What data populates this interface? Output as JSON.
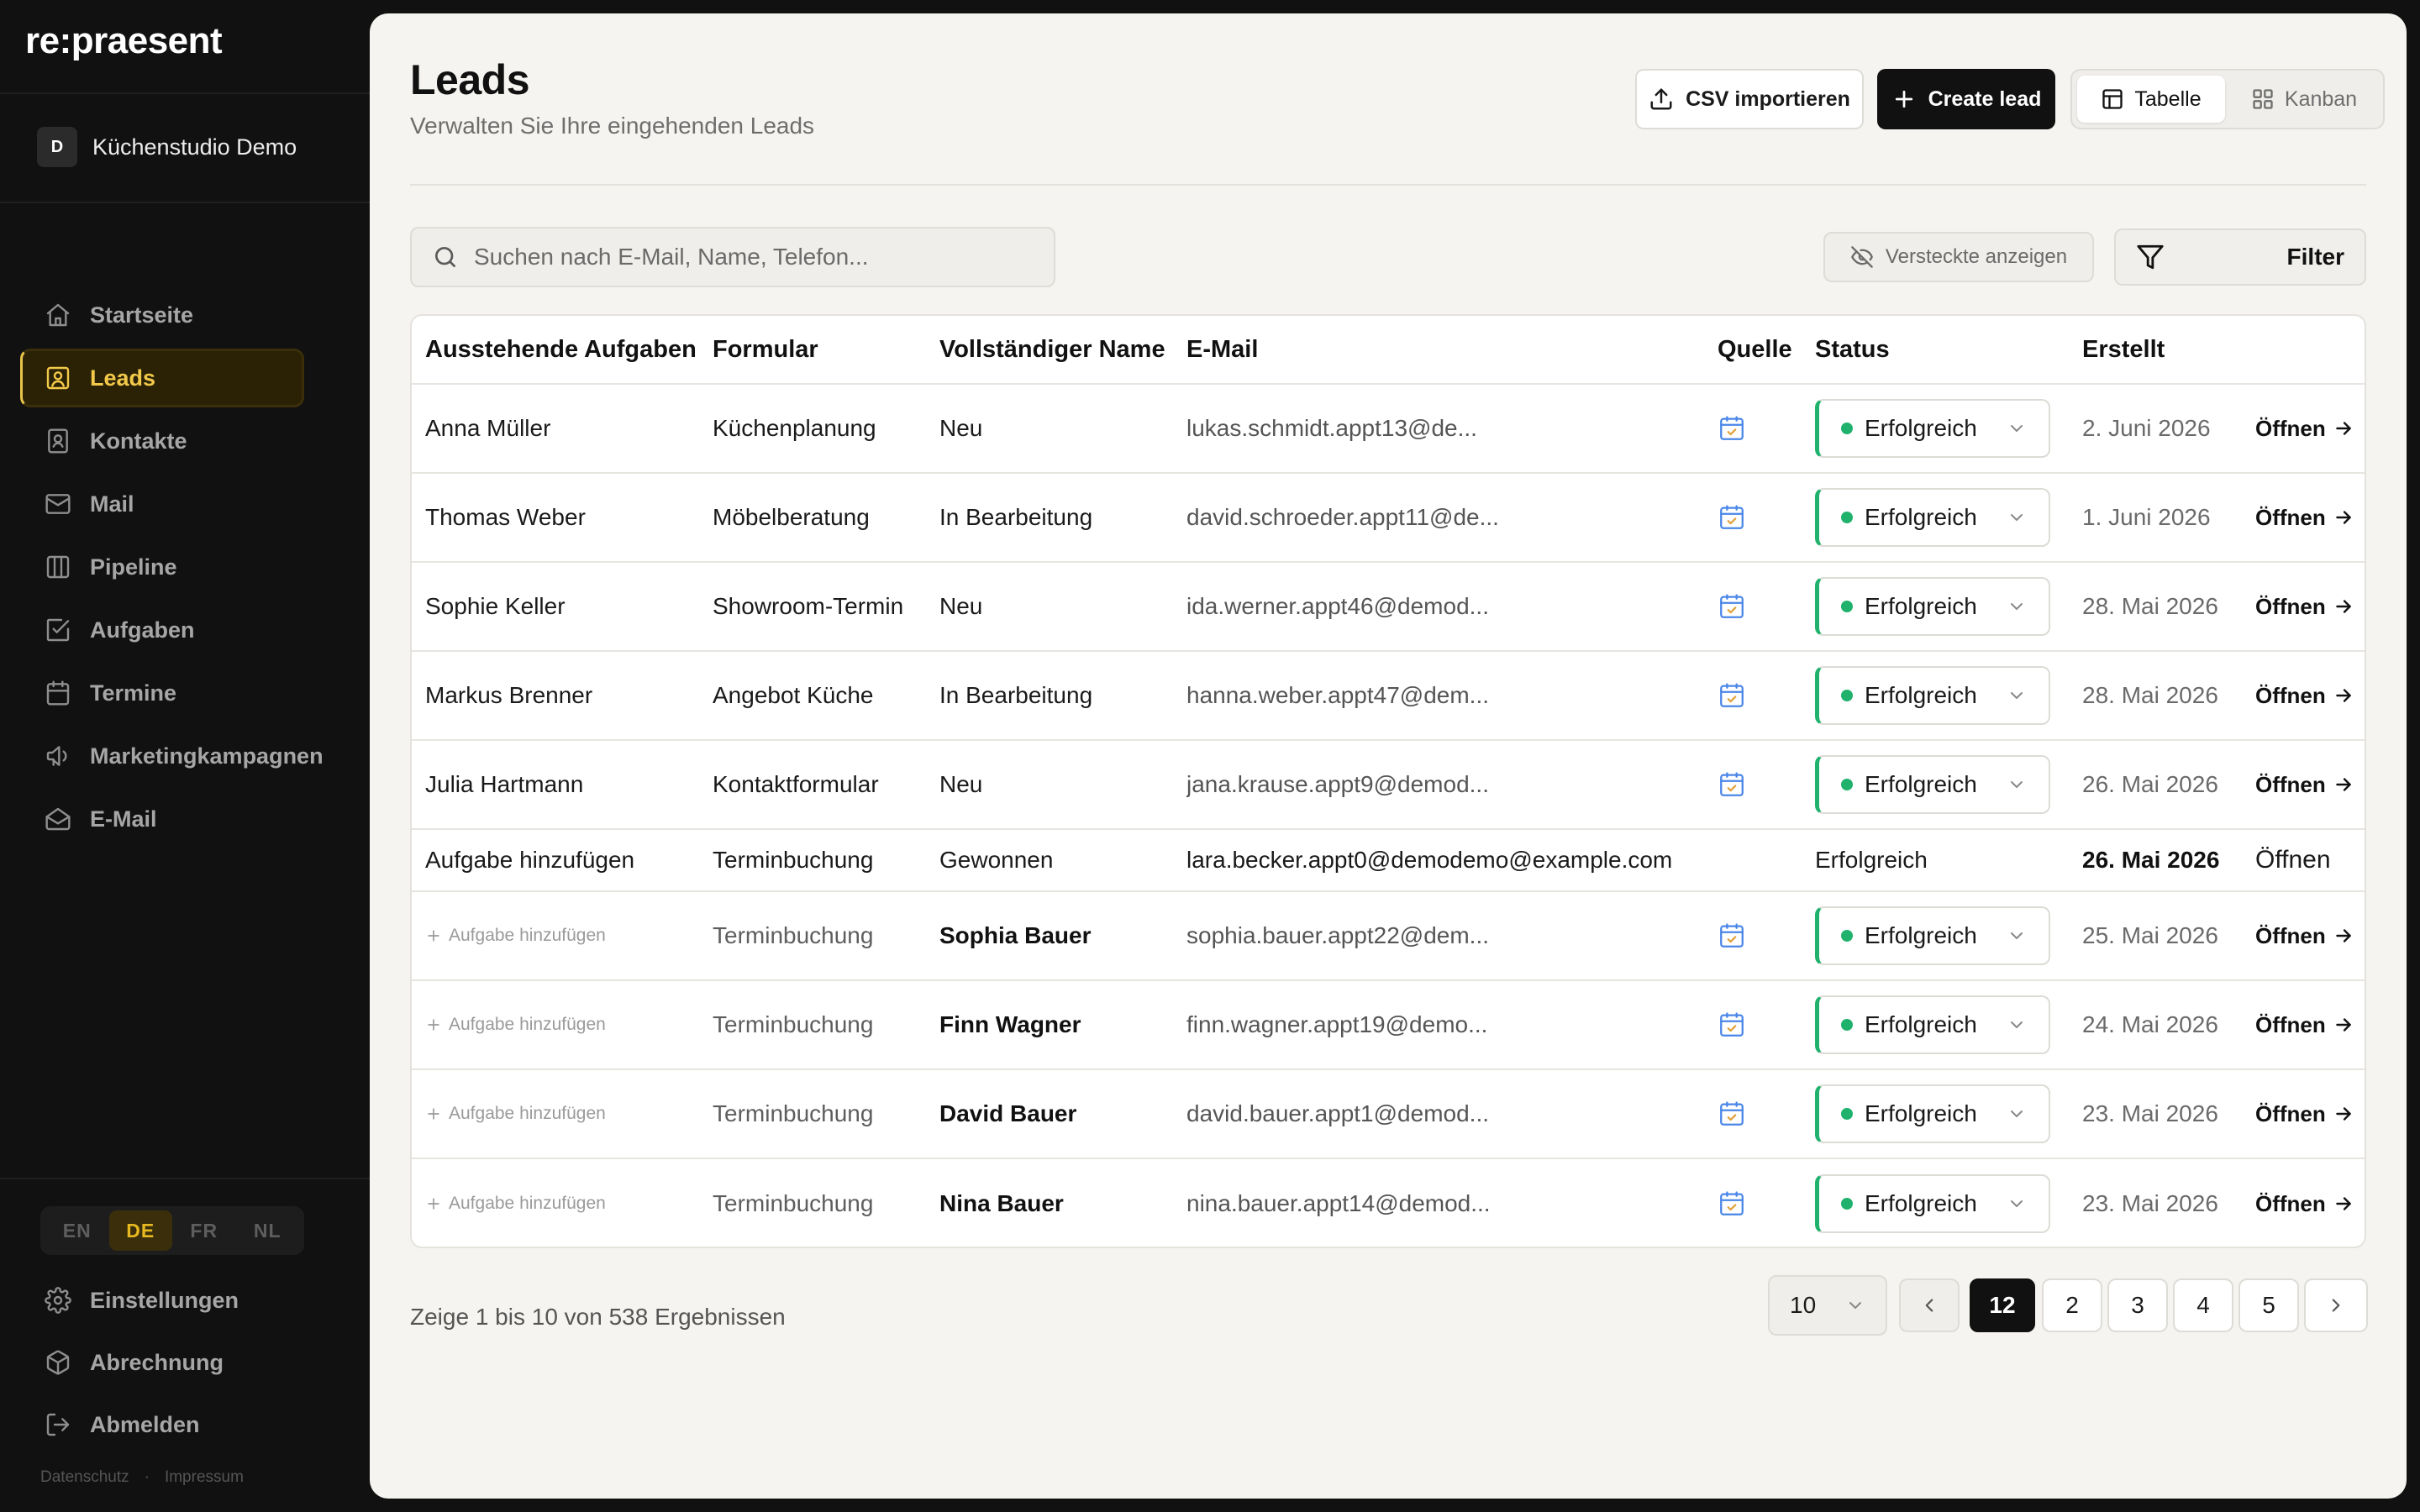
{
  "sidebar": {
    "brand": "re:praesent",
    "workspace": {
      "initial": "D",
      "name": "Küchenstudio Demo"
    },
    "nav": [
      {
        "label": "Startseite",
        "icon": "home-icon"
      },
      {
        "label": "Leads",
        "icon": "contact-card-icon",
        "active": true
      },
      {
        "label": "Kontakte",
        "icon": "contact-book-icon"
      },
      {
        "label": "Mail",
        "icon": "mail-icon"
      },
      {
        "label": "Pipeline",
        "icon": "columns-icon"
      },
      {
        "label": "Aufgaben",
        "icon": "checkbox-icon"
      },
      {
        "label": "Termine",
        "icon": "calendar-icon"
      },
      {
        "label": "Marketingkampagnen",
        "icon": "megaphone-icon"
      },
      {
        "label": "E-Mail",
        "icon": "envelope-open-icon"
      }
    ],
    "languages": [
      "EN",
      "DE",
      "FR",
      "NL"
    ],
    "active_language": "DE",
    "bottom": {
      "settings": "Einstellungen",
      "billing": "Abrechnung",
      "logout": "Abmelden"
    },
    "legal": {
      "privacy": "Datenschutz",
      "separator": "·",
      "imprint": "Impressum"
    }
  },
  "header": {
    "title": "Leads",
    "subtitle": "Verwalten Sie Ihre eingehenden Leads",
    "import_label": "CSV importieren",
    "create_label": "Create lead",
    "view_table": "Tabelle",
    "view_kanban": "Kanban"
  },
  "toolbar": {
    "search_placeholder": "Suchen nach E-Mail, Name, Telefon...",
    "show_hidden": "Versteckte anzeigen",
    "filter": "Filter"
  },
  "table": {
    "columns": [
      "Ausstehende Aufgaben",
      "Formular",
      "Vollständiger Name",
      "E-Mail",
      "Quelle",
      "Status",
      "Erstellt"
    ],
    "rows": [
      {
        "task": "Anna Müller",
        "form": "Küchenplanung",
        "name": "Neu",
        "email": "lukas.schmidt.appt13@de...",
        "status": "Erfolgreich",
        "created": "2. Juni 2026",
        "open": "Öffnen"
      },
      {
        "task": "Thomas Weber",
        "form": "Möbelberatung",
        "name": "In Bearbeitung",
        "email": "david.schroeder.appt11@de...",
        "status": "Erfolgreich",
        "created": "1. Juni 2026",
        "open": "Öffnen"
      },
      {
        "task": "Sophie Keller",
        "form": "Showroom-Termin",
        "name": "Neu",
        "email": "ida.werner.appt46@demod...",
        "status": "Erfolgreich",
        "created": "28. Mai 2026",
        "open": "Öffnen"
      },
      {
        "task": "Markus Brenner",
        "form": "Angebot Küche",
        "name": "In Bearbeitung",
        "email": "hanna.weber.appt47@dem...",
        "status": "Erfolgreich",
        "created": "28. Mai 2026",
        "open": "Öffnen"
      },
      {
        "task": "Julia Hartmann",
        "form": "Kontaktformular",
        "name": "Neu",
        "email": "jana.krause.appt9@demod...",
        "status": "Erfolgreich",
        "created": "26. Mai 2026",
        "open": "Öffnen"
      }
    ],
    "plain_row": {
      "task": "Aufgabe hinzufügen",
      "form": "Terminbuchung",
      "name": "Gewonnen",
      "email": "lara.becker.appt0@demodemo@example.com",
      "status": "Erfolgreich",
      "created": "26. Mai 2026",
      "open": "Öffnen"
    },
    "task_rows": [
      {
        "task": "Aufgabe hinzufügen",
        "form": "Terminbuchung",
        "name": "Sophia Bauer",
        "email": "sophia.bauer.appt22@dem...",
        "status": "Erfolgreich",
        "created": "25. Mai 2026",
        "open": "Öffnen"
      },
      {
        "task": "Aufgabe hinzufügen",
        "form": "Terminbuchung",
        "name": "Finn Wagner",
        "email": "finn.wagner.appt19@demo...",
        "status": "Erfolgreich",
        "created": "24. Mai 2026",
        "open": "Öffnen"
      },
      {
        "task": "Aufgabe hinzufügen",
        "form": "Terminbuchung",
        "name": "David Bauer",
        "email": "david.bauer.appt1@demod...",
        "status": "Erfolgreich",
        "created": "23. Mai 2026",
        "open": "Öffnen"
      },
      {
        "task": "Aufgabe hinzufügen",
        "form": "Terminbuchung",
        "name": "Nina Bauer",
        "email": "nina.bauer.appt14@demod...",
        "status": "Erfolgreich",
        "created": "23. Mai 2026",
        "open": "Öffnen"
      }
    ],
    "status_color": "#20b26c",
    "source_icon": "calendar-check-icon"
  },
  "pagination": {
    "summary": "Zeige 1 bis 10 von 538 Ergebnissen",
    "per_page": "10",
    "pages": [
      "12",
      "2",
      "3",
      "4",
      "5"
    ],
    "active_page": "12"
  },
  "colors": {
    "accent": "#f3c94a",
    "sidebar_bg": "#111111",
    "main_bg": "#f5f4f0",
    "success": "#20b26c"
  }
}
